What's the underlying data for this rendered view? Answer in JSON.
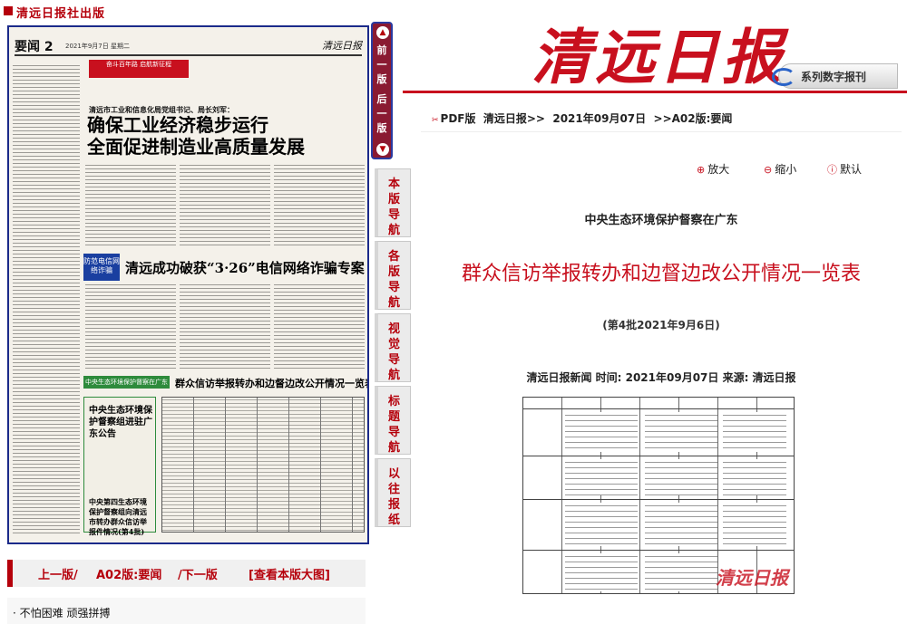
{
  "brand": {
    "publisher": "清远日报社出版"
  },
  "newspaper_page": {
    "page_label": "要闻 2",
    "date_line": "2021年9月7日 星期二",
    "logo": "清远日报",
    "banner": "奋斗百年路 启航新征程",
    "kicker": "清远市工业和信息化局党组书记、局长刘军：",
    "headline_1": "确保工业经济稳步运行",
    "headline_2": "全面促进制造业高质量发展",
    "badge": "防范电信网络诈骗",
    "headline_3": "清远成功破获“3·26”电信网络诈骗专案",
    "green_bar": "中央生态环境保护督察在广东",
    "headline_4": "群众信访举报转办和边督边改公开情况一览表",
    "sidebox_title": "中央生态环境保护督察组进驻广东公告",
    "sidebox_title_2": "中央第四生态环境保护督察组向清远市转办群众信访举报件情况(第4批)"
  },
  "vnav": {
    "prev": "前一版",
    "next": "后一版",
    "up_icon": "chevron-up-icon",
    "down_icon": "chevron-down-icon"
  },
  "sidetabs": [
    "本版导航",
    "各版导航",
    "视觉导航",
    "标题导航",
    "以往报纸"
  ],
  "page_nav": {
    "prev": "上一版/",
    "current": "A02版:要闻",
    "next": "/下一版",
    "view_large": "[查看本版大图]"
  },
  "headline_list": [
    "· 不怕困难  顽强拼搏"
  ],
  "masthead": {
    "title": "清远日报",
    "series": "系列数字报刊"
  },
  "breadcrumb": {
    "pdf": "PDF版",
    "paper": "清远日报>>",
    "date": "2021年09月07日",
    "page": ">>A02版:要闻"
  },
  "zoom": {
    "enlarge": "放大",
    "shrink": "缩小",
    "default": "默认"
  },
  "article": {
    "supertitle": "中央生态环境保护督察在广东",
    "title": "群众信访举报转办和边督边改公开情况一览表",
    "subtitle": "(第4批2021年9月6日)",
    "meta": "清远日报新闻 时间: 2021年09月07日 来源: 清远日报",
    "watermark": "清远日报"
  },
  "colors": {
    "brand_red": "#c8101e",
    "nav_blue": "#1b2a8a",
    "maroon": "#8a1a32"
  }
}
